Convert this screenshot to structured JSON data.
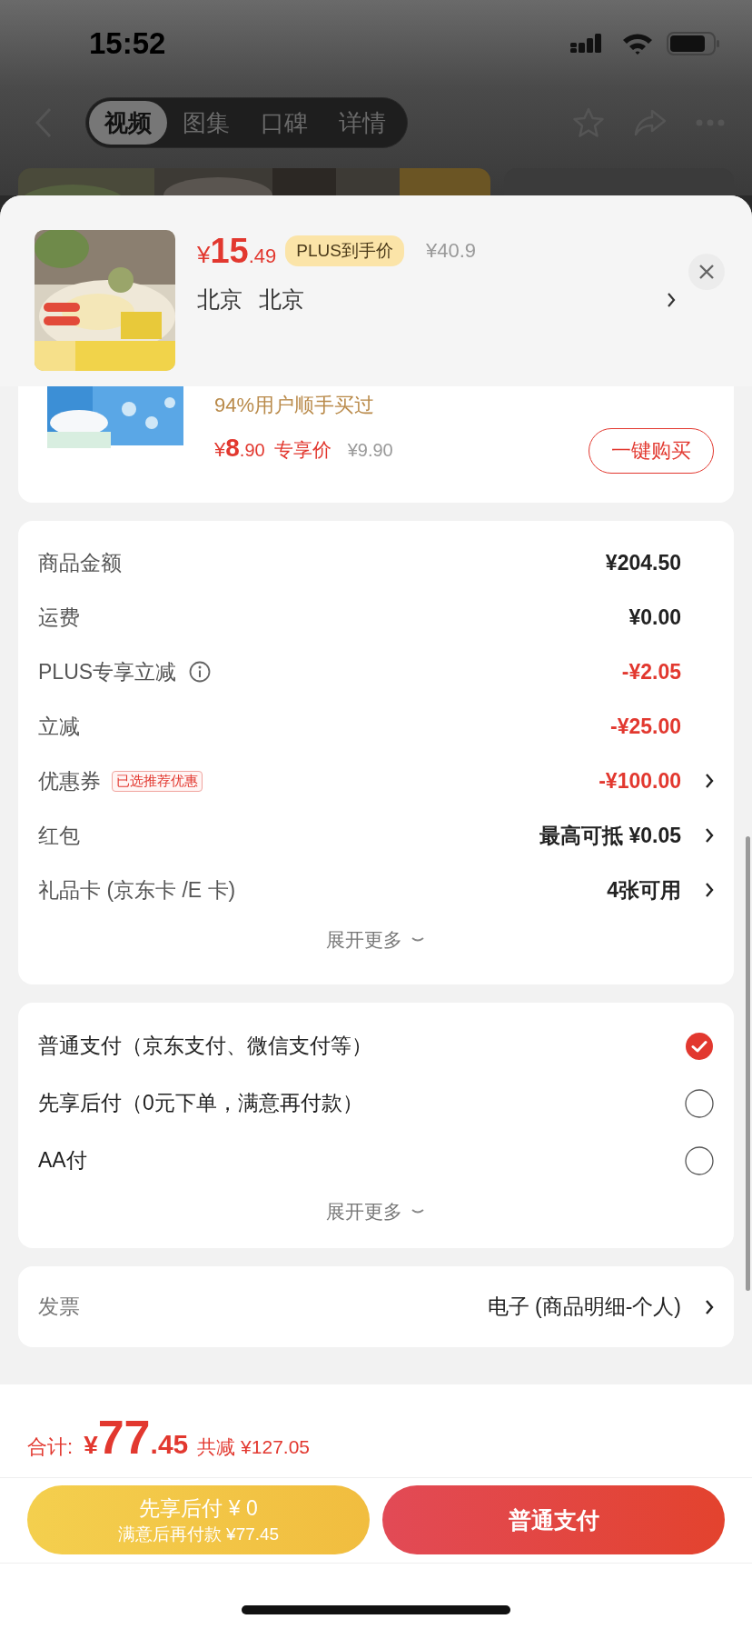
{
  "status_bar": {
    "time": "15:52"
  },
  "nav": {
    "tabs": [
      {
        "label": "视频",
        "selected": true
      },
      {
        "label": "图集",
        "selected": false
      },
      {
        "label": "口碑",
        "selected": false
      },
      {
        "label": "详情",
        "selected": false
      }
    ]
  },
  "product": {
    "currency": "¥",
    "price_int": "15",
    "price_dec": ".49",
    "badge": "PLUS到手价",
    "original_price": "¥40.9",
    "location": [
      "北京",
      "北京"
    ]
  },
  "addon": {
    "note": "94%用户顺手买过",
    "currency": "¥",
    "price_int": "8",
    "price_dec": ".90",
    "price_label": "专享价",
    "original_price": "¥9.90",
    "button": "一键购买"
  },
  "summary": {
    "rows": [
      {
        "label": "商品金额",
        "value": "¥204.50",
        "highlight": false,
        "info": false,
        "chevron": false
      },
      {
        "label": "运费",
        "value": "¥0.00",
        "highlight": false,
        "info": false,
        "chevron": false
      },
      {
        "label": "PLUS专享立减",
        "value": "-¥2.05",
        "highlight": true,
        "info": true,
        "chevron": false
      },
      {
        "label": "立减",
        "value": "-¥25.00",
        "highlight": true,
        "info": false,
        "chevron": false
      },
      {
        "label": "优惠券",
        "tag": "已选推荐优惠",
        "value": "-¥100.00",
        "highlight": true,
        "info": false,
        "chevron": true
      },
      {
        "label": "红包",
        "value": "最高可抵 ¥0.05",
        "highlight": false,
        "info": false,
        "chevron": true
      },
      {
        "label": "礼品卡 (京东卡 /E 卡)",
        "value": "4张可用",
        "highlight": false,
        "info": false,
        "chevron": true
      }
    ],
    "more": "展开更多"
  },
  "payment": {
    "options": [
      {
        "label": "普通支付（京东支付、微信支付等）",
        "selected": true
      },
      {
        "label": "先享后付（0元下单，满意再付款）",
        "selected": false
      },
      {
        "label": "AA付",
        "selected": false
      }
    ],
    "more": "展开更多"
  },
  "invoice": {
    "label": "发票",
    "value": "电子 (商品明细-个人)"
  },
  "footer": {
    "total_label": "合计:",
    "currency": "¥",
    "total_int": "77",
    "total_dec": ".45",
    "saved": "共减 ¥127.05",
    "later_button": {
      "title": "先享后付 ¥ 0",
      "subtitle": "满意后再付款 ¥77.45"
    },
    "pay_button": "普通支付"
  }
}
